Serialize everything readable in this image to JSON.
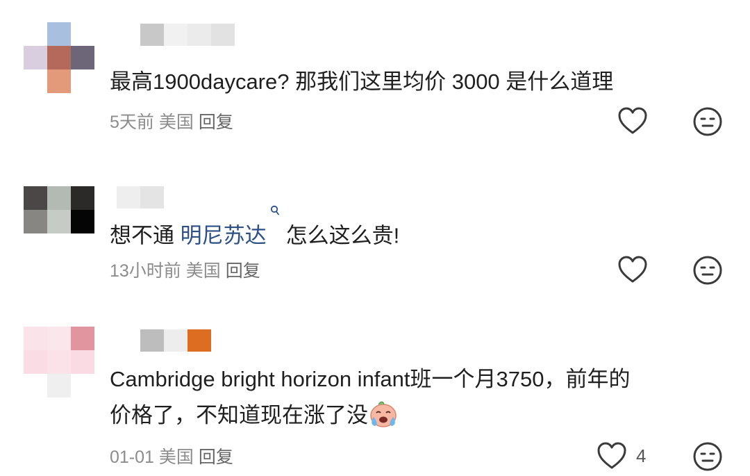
{
  "comments": [
    {
      "text": "最高1900daycare?  那我们这里均价 3000 是什么道理",
      "time": "5天前",
      "location": "美国",
      "reply": "回复"
    },
    {
      "text_before": "想不通 ",
      "mention": "明尼苏达",
      "mention_icon": "search-icon",
      "text_after": " 怎么这么贵!",
      "time": "13小时前",
      "location": "美国",
      "reply": "回复"
    },
    {
      "line1": "Cambridge bright horizon infant班一个月3750，前年的",
      "line2": "价格了，不知道现在涨了没",
      "emoji": "crying-face-emoji",
      "time": "01-01",
      "location": "美国",
      "reply": "回复",
      "like_count": "4"
    }
  ],
  "icons": {
    "like": "heart-outline-icon",
    "reaction": "neutral-face-icon"
  },
  "colors": {
    "text": "#1f1f1f",
    "meta": "#8c8c8c",
    "mention": "#2c4f86",
    "icon_stroke": "#3a3a3a"
  }
}
